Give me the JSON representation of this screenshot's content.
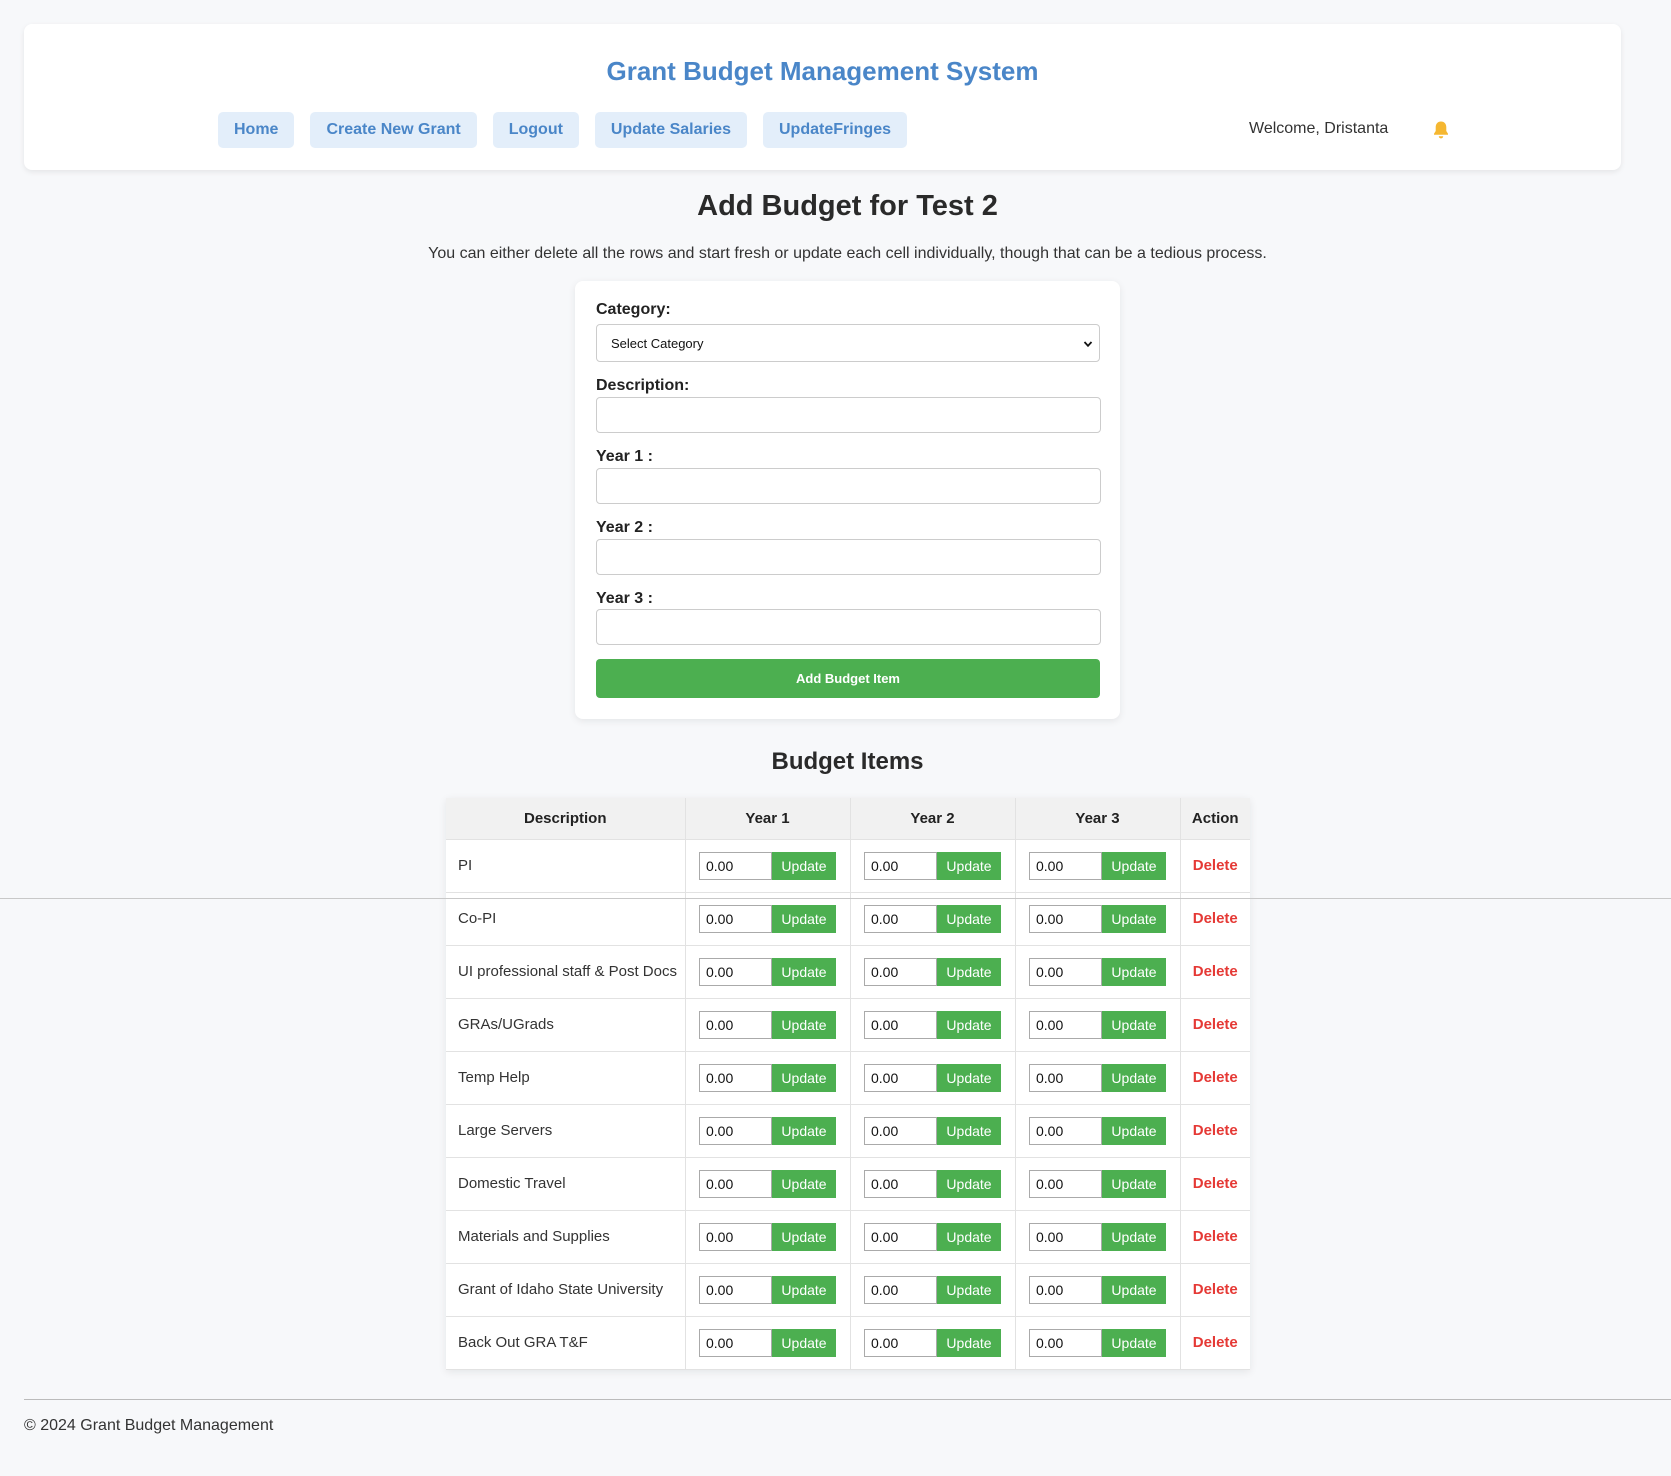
{
  "header": {
    "title": "Grant Budget Management System",
    "nav": [
      "Home",
      "Create New Grant",
      "Logout",
      "Update Salaries",
      "UpdateFringes"
    ],
    "welcome": "Welcome, Dristanta"
  },
  "page": {
    "title": "Add Budget for Test 2",
    "intro": "You can either delete all the rows and start fresh or update each cell individually, though that can be a tedious process."
  },
  "form": {
    "category_label": "Category:",
    "category_value": "Select Category",
    "description_label": "Description:",
    "year1_label": "Year 1 :",
    "year2_label": "Year 2 :",
    "year3_label": "Year 3 :",
    "submit_label": "Add Budget Item"
  },
  "items": {
    "title": "Budget Items",
    "columns": [
      "Description",
      "Year 1",
      "Year 2",
      "Year 3",
      "Action"
    ],
    "update_label": "Update",
    "delete_label": "Delete",
    "rows": [
      {
        "description": "PI",
        "year1": "0.00",
        "year2": "0.00",
        "year3": "0.00"
      },
      {
        "description": "Co-PI",
        "year1": "0.00",
        "year2": "0.00",
        "year3": "0.00"
      },
      {
        "description": "UI professional staff & Post Docs",
        "year1": "0.00",
        "year2": "0.00",
        "year3": "0.00"
      },
      {
        "description": "GRAs/UGrads",
        "year1": "0.00",
        "year2": "0.00",
        "year3": "0.00"
      },
      {
        "description": "Temp Help",
        "year1": "0.00",
        "year2": "0.00",
        "year3": "0.00"
      },
      {
        "description": "Large Servers",
        "year1": "0.00",
        "year2": "0.00",
        "year3": "0.00"
      },
      {
        "description": "Domestic Travel",
        "year1": "0.00",
        "year2": "0.00",
        "year3": "0.00"
      },
      {
        "description": "Materials and Supplies",
        "year1": "0.00",
        "year2": "0.00",
        "year3": "0.00"
      },
      {
        "description": "Grant of Idaho State University",
        "year1": "0.00",
        "year2": "0.00",
        "year3": "0.00"
      },
      {
        "description": "Back Out GRA T&F",
        "year1": "0.00",
        "year2": "0.00",
        "year3": "0.00"
      }
    ]
  },
  "footer": {
    "text": "© 2024 Grant Budget Management"
  },
  "colors": {
    "brand": "#4a86c8",
    "accent_green": "#4caf50",
    "danger": "#e53935"
  },
  "icons": {
    "notification": "bell-icon",
    "dropdown": "chevron-down-icon"
  }
}
